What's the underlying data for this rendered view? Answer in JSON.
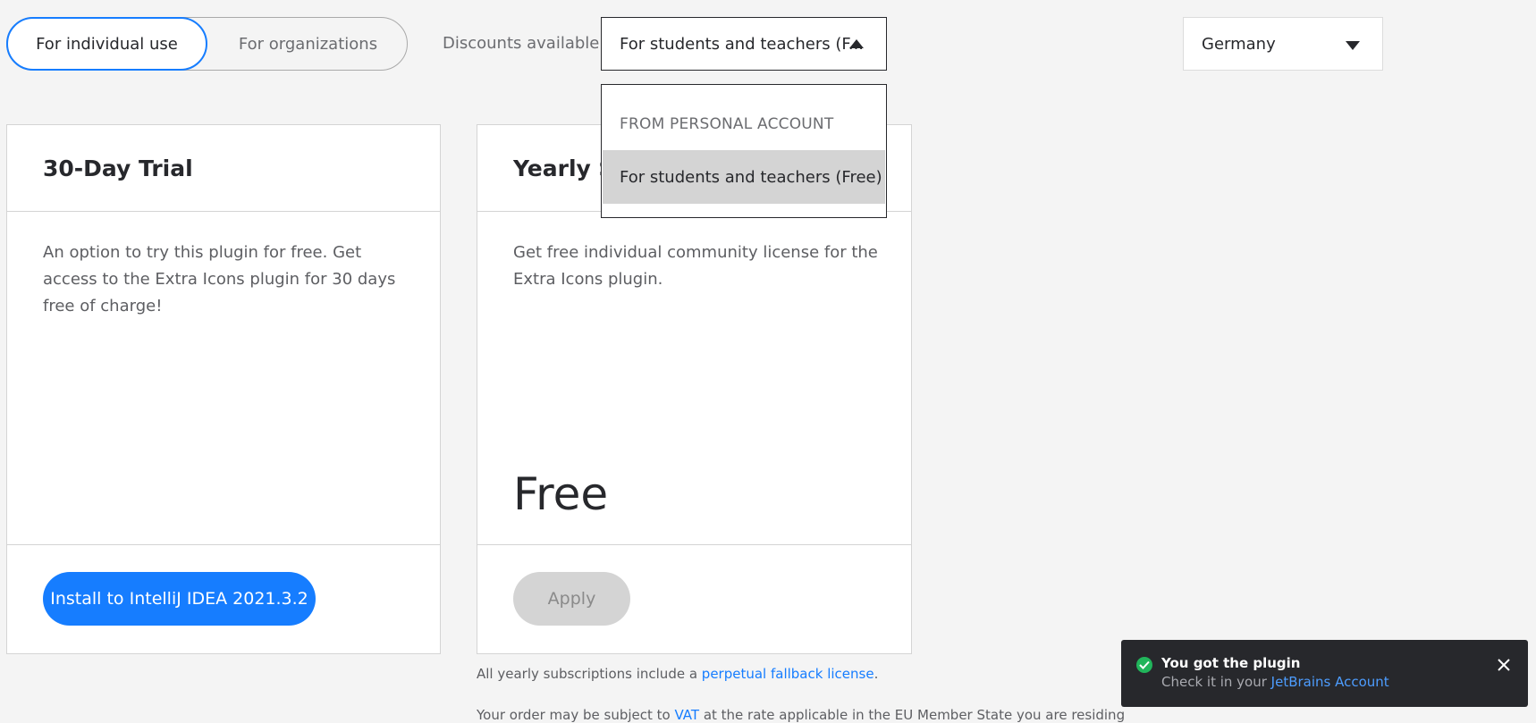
{
  "toggle": {
    "individual_label": "For individual use",
    "organizations_label": "For organizations"
  },
  "discounts": {
    "label": "Discounts available:",
    "selected": "For students and teachers (F...",
    "dropdown": {
      "group_label": "FROM PERSONAL ACCOUNT",
      "options": [
        "For students and teachers (Free)"
      ]
    }
  },
  "country": {
    "selected": "Germany"
  },
  "cards": [
    {
      "title": "30-Day Trial",
      "description": "An option to try this plugin for free. Get access to the Extra Icons plugin for 30 days free of charge!",
      "button_label": "Install to IntelliJ IDEA 2021.3.2"
    },
    {
      "title": "Yearly Subscription",
      "title_visible": "Yearly Su",
      "description": "Get free individual community license for the Extra Icons plugin.",
      "price": "Free",
      "button_label": "Apply"
    }
  ],
  "footnote": {
    "prefix": "All yearly subscriptions include a ",
    "link": "perpetual fallback license",
    "suffix": "."
  },
  "footnote2": {
    "prefix": "Your order may be subject to ",
    "link": "VAT",
    "suffix": " at the rate applicable in the EU Member State you are residing"
  },
  "toast": {
    "title": "You got the plugin",
    "subtitle_prefix": "Check it in your ",
    "subtitle_link": "JetBrains Account"
  },
  "colors": {
    "accent": "#167dff",
    "success": "#21b55b",
    "toast_bg": "#27282c",
    "page_bg": "#f4f4f4"
  },
  "icons": {
    "discount_caret": "caret-up-icon",
    "country_caret": "caret-down-icon",
    "toast_status": "check-circle-icon",
    "toast_close": "close-icon"
  }
}
